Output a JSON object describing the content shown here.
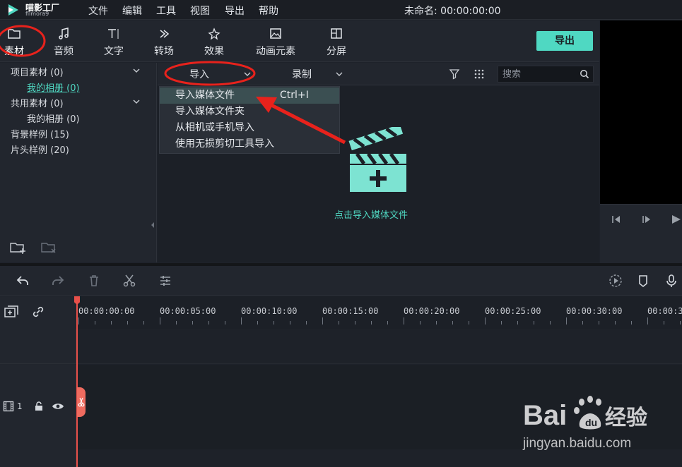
{
  "app": {
    "logo_name": "喵影工厂",
    "logo_sub": "filmora9",
    "project_title": "未命名: 00:00:00:00"
  },
  "menu": [
    "文件",
    "编辑",
    "工具",
    "视图",
    "导出",
    "帮助"
  ],
  "toolbar": {
    "tools": [
      {
        "label": "素材",
        "icon": "folder-icon",
        "active": true
      },
      {
        "label": "音频",
        "icon": "music-note-icon"
      },
      {
        "label": "文字",
        "icon": "text-icon"
      },
      {
        "label": "转场",
        "icon": "transition-icon"
      },
      {
        "label": "效果",
        "icon": "effects-icon"
      },
      {
        "label": "动画元素",
        "icon": "image-icon"
      },
      {
        "label": "分屏",
        "icon": "split-screen-icon"
      }
    ],
    "export_label": "导出"
  },
  "library": {
    "items": [
      {
        "label": "项目素材 (0)",
        "expandable": true
      },
      {
        "label": "我的相册 (0)",
        "selected": true
      },
      {
        "label": "共用素材 (0)",
        "expandable": true
      },
      {
        "label": "我的相册 (0)"
      },
      {
        "label": "背景样例 (15)"
      },
      {
        "label": "片头样例 (20)"
      }
    ]
  },
  "media": {
    "import_label": "导入",
    "record_label": "录制",
    "search_placeholder": "搜索",
    "dropdown": [
      {
        "label": "导入媒体文件",
        "shortcut": "Ctrl+I"
      },
      {
        "label": "导入媒体文件夹"
      },
      {
        "label": "从相机或手机导入"
      },
      {
        "label": "使用无损剪切工具导入"
      }
    ],
    "hint": "点击导入媒体文件"
  },
  "timeline": {
    "ticks": [
      "00:00:00:00",
      "00:00:05:00",
      "00:00:10:00",
      "00:00:15:00",
      "00:00:20:00",
      "00:00:25:00",
      "00:00:30:00",
      "00:00:3"
    ],
    "track_number": "1"
  },
  "watermark": {
    "brand": "Bai du 经验",
    "url": "jingyan.baidu.com"
  },
  "colors": {
    "accent": "#4fd8c2",
    "annotation": "#e8221c",
    "playhead": "#e8504a"
  }
}
